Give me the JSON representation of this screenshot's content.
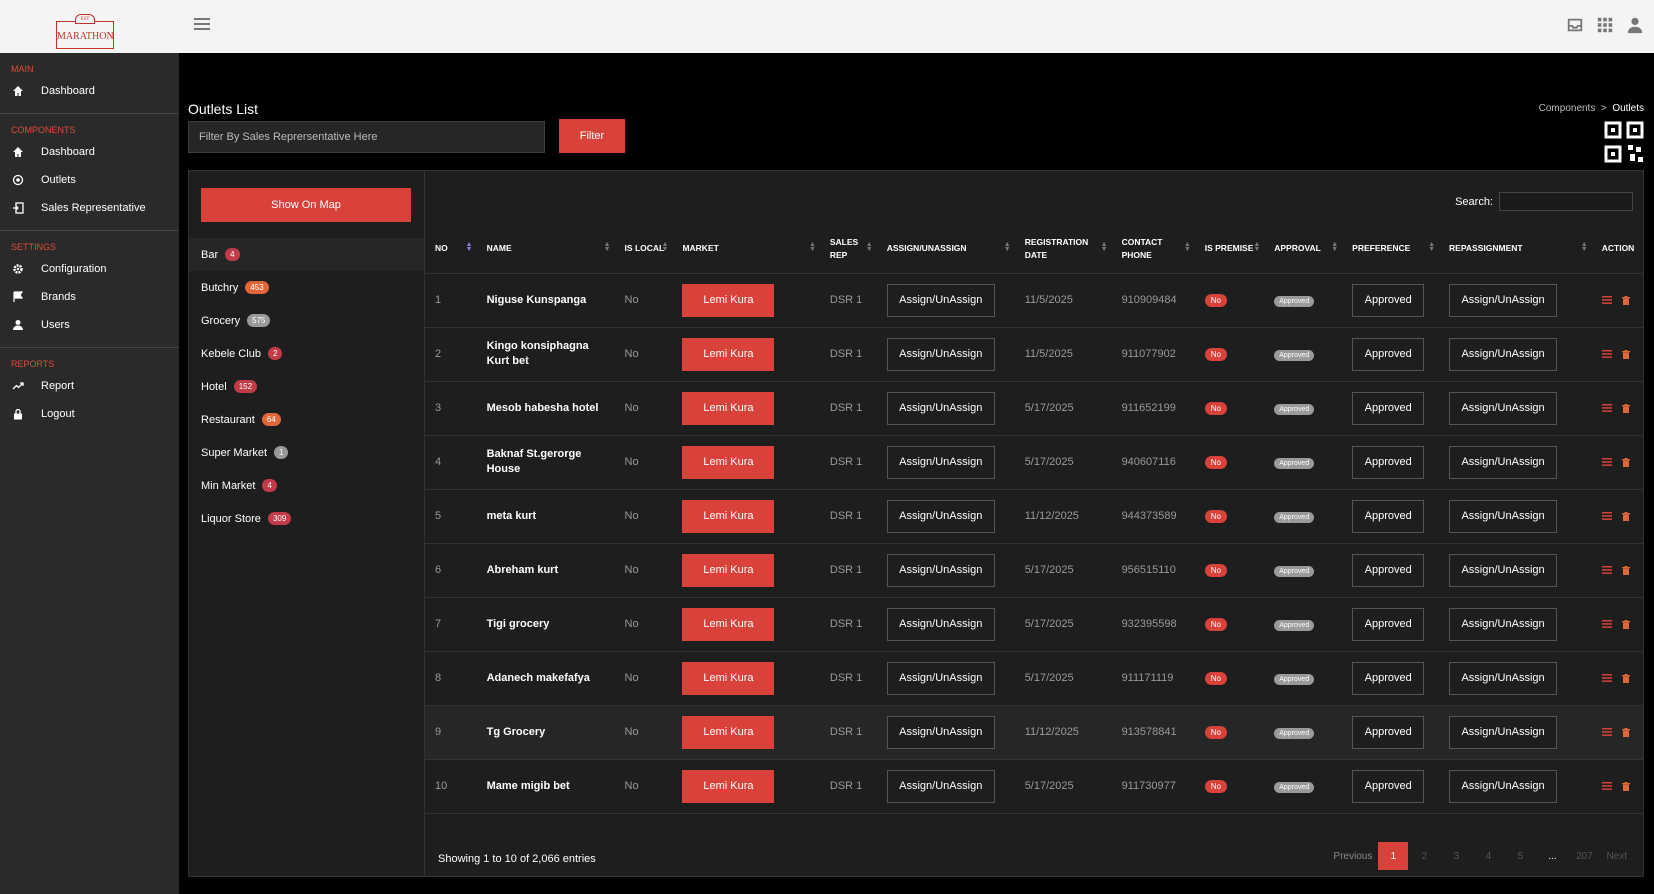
{
  "brand": {
    "logo_text": "MARATHON",
    "logo_sup": "EST"
  },
  "sidebar": {
    "sections": [
      {
        "title": "MAIN",
        "items": [
          {
            "label": "Dashboard",
            "icon": "home-icon"
          }
        ]
      },
      {
        "title": "COMPONENTS",
        "items": [
          {
            "label": "Dashboard",
            "icon": "home-icon"
          },
          {
            "label": "Outlets",
            "icon": "target-icon"
          },
          {
            "label": "Sales Representative",
            "icon": "login-icon"
          }
        ]
      },
      {
        "title": "SETTINGS",
        "items": [
          {
            "label": "Configuration",
            "icon": "gear-icon"
          },
          {
            "label": "Brands",
            "icon": "flag-icon"
          },
          {
            "label": "Users",
            "icon": "user-icon"
          }
        ]
      },
      {
        "title": "REPORTS",
        "items": [
          {
            "label": "Report",
            "icon": "trend-icon"
          },
          {
            "label": "Logout",
            "icon": "lock-icon"
          }
        ]
      }
    ]
  },
  "page": {
    "title": "Outlets List",
    "filter_placeholder": "Filter By Sales Reprersentative Here",
    "filter_label": "Filter",
    "breadcrumb": {
      "parent": "Components",
      "sep": ">",
      "current": "Outlets"
    }
  },
  "categories": {
    "show_map_label": "Show On Map",
    "items": [
      {
        "label": "Bar",
        "count": "4",
        "color": "red"
      },
      {
        "label": "Butchry",
        "count": "453",
        "color": "orange"
      },
      {
        "label": "Grocery",
        "count": "575",
        "color": "gray"
      },
      {
        "label": "Kebele Club",
        "count": "2",
        "color": "red"
      },
      {
        "label": "Hotel",
        "count": "152",
        "color": "red"
      },
      {
        "label": "Restaurant",
        "count": "64",
        "color": "orange"
      },
      {
        "label": "Super Market",
        "count": "1",
        "color": "gray"
      },
      {
        "label": "Min Market",
        "count": "4",
        "color": "red"
      },
      {
        "label": "Liquor Store",
        "count": "309",
        "color": "red"
      }
    ]
  },
  "table": {
    "search_label": "Search:",
    "columns": [
      "NO",
      "NAME",
      "IS LOCAL",
      "MARKET",
      "SALES REP",
      "ASSIGN/UNASSIGN",
      "REGISTRATION DATE",
      "CONTACT PHONE",
      "IS PREMISE",
      "APPROVAL",
      "PREFERENCE",
      "REPASSIGNMENT",
      "ACTION"
    ],
    "rows": [
      {
        "no": "1",
        "name": "Niguse Kunspanga",
        "is_local": "No",
        "market": "Lemi Kura",
        "sales_rep": "DSR 1",
        "assign": "Assign/UnAssign",
        "date": "11/5/2025",
        "phone": "910909484",
        "premise": "No",
        "approval": "Approved",
        "preference": "Approved",
        "reassign": "Assign/UnAssign"
      },
      {
        "no": "2",
        "name": "Kingo konsiphagna Kurt bet",
        "is_local": "No",
        "market": "Lemi Kura",
        "sales_rep": "DSR 1",
        "assign": "Assign/UnAssign",
        "date": "11/5/2025",
        "phone": "911077902",
        "premise": "No",
        "approval": "Approved",
        "preference": "Approved",
        "reassign": "Assign/UnAssign"
      },
      {
        "no": "3",
        "name": "Mesob habesha hotel",
        "is_local": "No",
        "market": "Lemi Kura",
        "sales_rep": "DSR 1",
        "assign": "Assign/UnAssign",
        "date": "5/17/2025",
        "phone": "911652199",
        "premise": "No",
        "approval": "Approved",
        "preference": "Approved",
        "reassign": "Assign/UnAssign"
      },
      {
        "no": "4",
        "name": "Baknaf St.gerorge House",
        "is_local": "No",
        "market": "Lemi Kura",
        "sales_rep": "DSR 1",
        "assign": "Assign/UnAssign",
        "date": "5/17/2025",
        "phone": "940607116",
        "premise": "No",
        "approval": "Approved",
        "preference": "Approved",
        "reassign": "Assign/UnAssign"
      },
      {
        "no": "5",
        "name": "meta kurt",
        "is_local": "No",
        "market": "Lemi Kura",
        "sales_rep": "DSR 1",
        "assign": "Assign/UnAssign",
        "date": "11/12/2025",
        "phone": "944373589",
        "premise": "No",
        "approval": "Approved",
        "preference": "Approved",
        "reassign": "Assign/UnAssign"
      },
      {
        "no": "6",
        "name": "Abreham kurt",
        "is_local": "No",
        "market": "Lemi Kura",
        "sales_rep": "DSR 1",
        "assign": "Assign/UnAssign",
        "date": "5/17/2025",
        "phone": "956515110",
        "premise": "No",
        "approval": "Approved",
        "preference": "Approved",
        "reassign": "Assign/UnAssign"
      },
      {
        "no": "7",
        "name": "Tigi grocery",
        "is_local": "No",
        "market": "Lemi Kura",
        "sales_rep": "DSR 1",
        "assign": "Assign/UnAssign",
        "date": "5/17/2025",
        "phone": "932395598",
        "premise": "No",
        "approval": "Approved",
        "preference": "Approved",
        "reassign": "Assign/UnAssign"
      },
      {
        "no": "8",
        "name": "Adanech makefafya",
        "is_local": "No",
        "market": "Lemi Kura",
        "sales_rep": "DSR 1",
        "assign": "Assign/UnAssign",
        "date": "5/17/2025",
        "phone": "911171119",
        "premise": "No",
        "approval": "Approved",
        "preference": "Approved",
        "reassign": "Assign/UnAssign"
      },
      {
        "no": "9",
        "name": "Tg Grocery",
        "is_local": "No",
        "market": "Lemi Kura",
        "sales_rep": "DSR 1",
        "assign": "Assign/UnAssign",
        "date": "11/12/2025",
        "phone": "913578841",
        "premise": "No",
        "approval": "Approved",
        "preference": "Approved",
        "reassign": "Assign/UnAssign"
      },
      {
        "no": "10",
        "name": "Mame migib bet",
        "is_local": "No",
        "market": "Lemi Kura",
        "sales_rep": "DSR 1",
        "assign": "Assign/UnAssign",
        "date": "5/17/2025",
        "phone": "911730977",
        "premise": "No",
        "approval": "Approved",
        "preference": "Approved",
        "reassign": "Assign/UnAssign"
      }
    ],
    "showing": "Showing 1 to 10 of 2,066 entries",
    "pagination": [
      "Previous",
      "1",
      "2",
      "3",
      "4",
      "5",
      "...",
      "207",
      "Next"
    ]
  },
  "colors": {
    "accent": "#d9413b",
    "sidebar": "#2a2a2a",
    "panel": "#1e1e1e"
  }
}
